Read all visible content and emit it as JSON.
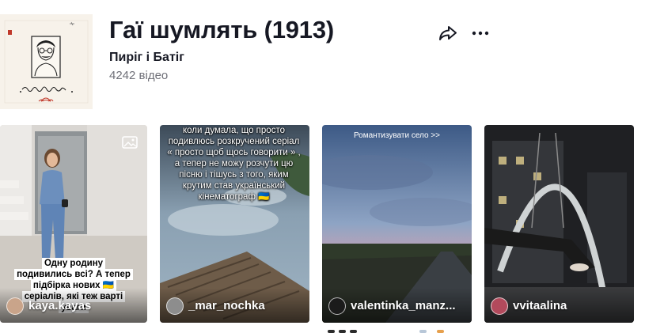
{
  "sound": {
    "title": "Гаї шумлять (1913)",
    "author": "Пиріг і Батіг",
    "video_count": "4242 відео",
    "cover_art_text": "пиріг і батіг"
  },
  "actions": {
    "share_icon": "share-arrow-icon",
    "more_icon": "more-dots-icon"
  },
  "videos": [
    {
      "username": "kaya.kayas",
      "caption": "Одну родину подивились всі? А тепер підбірка нових 🇺🇦 серіалів, які теж варті уваги",
      "badge_icon": "photo-gallery-icon"
    },
    {
      "username": "_mar_nochka",
      "caption": "коли думала, що просто подивлюсь розкручений серіал « просто щоб щось говорити » , а тепер не можу розчути цю пісню і тішусь з того, яким крутим став український кінематограф 🇺🇦"
    },
    {
      "username": "valentinka_manz...",
      "caption": "Романтизувати село >>"
    },
    {
      "username": "vvitaalina"
    }
  ]
}
